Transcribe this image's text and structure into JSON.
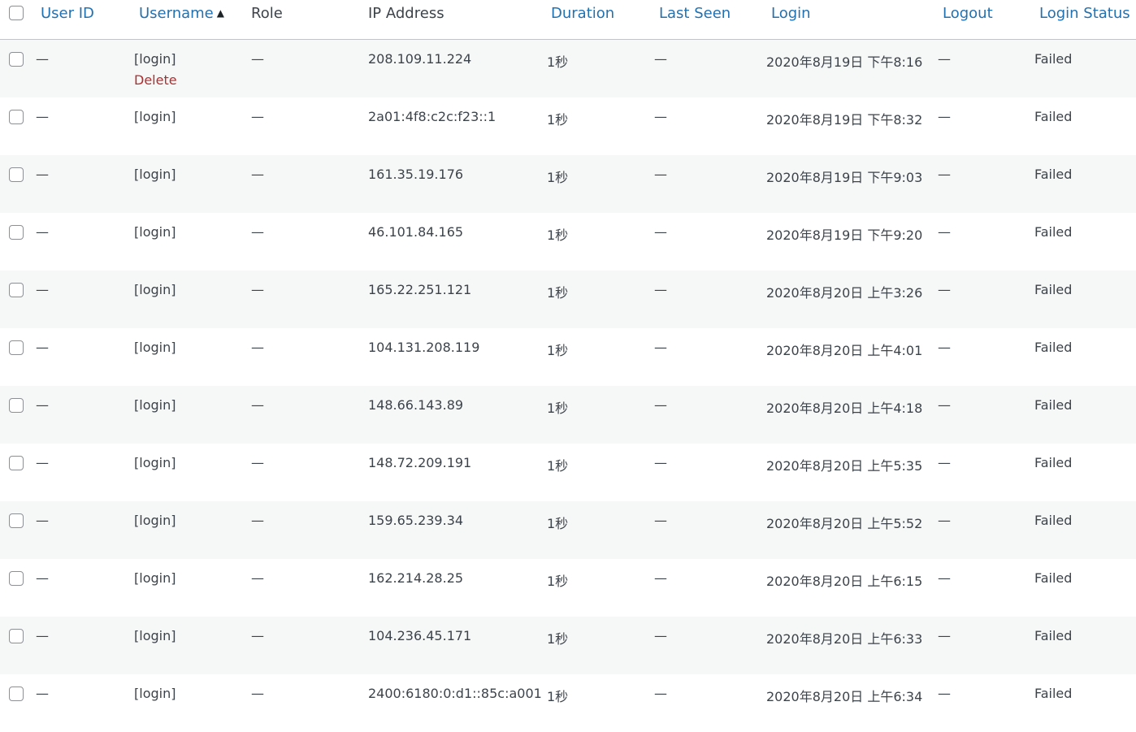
{
  "headers": {
    "user_id": "User ID",
    "username": "Username",
    "sort_indicator": "▲",
    "role": "Role",
    "ip": "IP Address",
    "duration": "Duration",
    "last_seen": "Last Seen",
    "login": "Login",
    "logout": "Logout",
    "status": "Login Status"
  },
  "row_action": {
    "delete": "Delete"
  },
  "rows": [
    {
      "user_id": "—",
      "username": "[login]",
      "role": "—",
      "ip": "208.109.11.224",
      "duration": "1秒",
      "last_seen": "—",
      "login": "2020年8月19日 下午8:16",
      "logout": "—",
      "status": "Failed"
    },
    {
      "user_id": "—",
      "username": "[login]",
      "role": "—",
      "ip": "2a01:4f8:c2c:f23::1",
      "duration": "1秒",
      "last_seen": "—",
      "login": "2020年8月19日 下午8:32",
      "logout": "—",
      "status": "Failed"
    },
    {
      "user_id": "—",
      "username": "[login]",
      "role": "—",
      "ip": "161.35.19.176",
      "duration": "1秒",
      "last_seen": "—",
      "login": "2020年8月19日 下午9:03",
      "logout": "—",
      "status": "Failed"
    },
    {
      "user_id": "—",
      "username": "[login]",
      "role": "—",
      "ip": "46.101.84.165",
      "duration": "1秒",
      "last_seen": "—",
      "login": "2020年8月19日 下午9:20",
      "logout": "—",
      "status": "Failed"
    },
    {
      "user_id": "—",
      "username": "[login]",
      "role": "—",
      "ip": "165.22.251.121",
      "duration": "1秒",
      "last_seen": "—",
      "login": "2020年8月20日 上午3:26",
      "logout": "—",
      "status": "Failed"
    },
    {
      "user_id": "—",
      "username": "[login]",
      "role": "—",
      "ip": "104.131.208.119",
      "duration": "1秒",
      "last_seen": "—",
      "login": "2020年8月20日 上午4:01",
      "logout": "—",
      "status": "Failed"
    },
    {
      "user_id": "—",
      "username": "[login]",
      "role": "—",
      "ip": "148.66.143.89",
      "duration": "1秒",
      "last_seen": "—",
      "login": "2020年8月20日 上午4:18",
      "logout": "—",
      "status": "Failed"
    },
    {
      "user_id": "—",
      "username": "[login]",
      "role": "—",
      "ip": "148.72.209.191",
      "duration": "1秒",
      "last_seen": "—",
      "login": "2020年8月20日 上午5:35",
      "logout": "—",
      "status": "Failed"
    },
    {
      "user_id": "—",
      "username": "[login]",
      "role": "—",
      "ip": "159.65.239.34",
      "duration": "1秒",
      "last_seen": "—",
      "login": "2020年8月20日 上午5:52",
      "logout": "—",
      "status": "Failed"
    },
    {
      "user_id": "—",
      "username": "[login]",
      "role": "—",
      "ip": "162.214.28.25",
      "duration": "1秒",
      "last_seen": "—",
      "login": "2020年8月20日 上午6:15",
      "logout": "—",
      "status": "Failed"
    },
    {
      "user_id": "—",
      "username": "[login]",
      "role": "—",
      "ip": "104.236.45.171",
      "duration": "1秒",
      "last_seen": "—",
      "login": "2020年8月20日 上午6:33",
      "logout": "—",
      "status": "Failed"
    },
    {
      "user_id": "—",
      "username": "[login]",
      "role": "—",
      "ip": "2400:6180:0:d1::85c:a001",
      "duration": "1秒",
      "last_seen": "—",
      "login": "2020年8月20日 上午6:34",
      "logout": "—",
      "status": "Failed"
    }
  ]
}
